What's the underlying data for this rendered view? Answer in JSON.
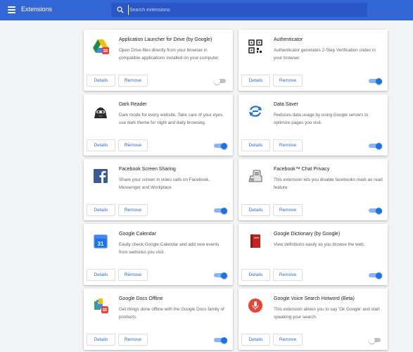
{
  "header": {
    "title": "Extensions",
    "search_placeholder": "Search extensions"
  },
  "extensions": [
    {
      "name": "Application Launcher for Drive (by Google)",
      "description": "Open Drive files directly from your browser in compatible applications installed on your computer.",
      "icon": "google-drive-icon",
      "enabled": false
    },
    {
      "name": "Authenticator",
      "description": "Authenticator generates 2-Step Verification codes in your browser.",
      "icon": "qr-code-icon",
      "enabled": true
    },
    {
      "name": "Dark Reader",
      "description": "Dark mode for every website. Take care of your eyes, use dark theme for night and daily browsing.",
      "icon": "dark-reader-icon",
      "enabled": true
    },
    {
      "name": "Data Saver",
      "description": "Reduces data usage by using Google servers to optimize pages you visit.",
      "icon": "data-saver-icon",
      "enabled": true
    },
    {
      "name": "Facebook Screen Sharing",
      "description": "Share your screen in video calls on Facebook, Messenger and Workplace",
      "icon": "facebook-icon",
      "enabled": true
    },
    {
      "name": "Facebook™ Chat Privacy",
      "description": "This extension lets you disable facebooks mark as read feature",
      "icon": "chat-privacy-icon",
      "enabled": true
    },
    {
      "name": "Google Calendar",
      "description": "Easily check Google Calendar and add new events from websites you visit.",
      "icon": "google-calendar-icon",
      "enabled": true
    },
    {
      "name": "Google Dictionary (by Google)",
      "description": "View definitions easily as you browse the web.",
      "icon": "dictionary-book-icon",
      "enabled": true
    },
    {
      "name": "Google Docs Offline",
      "description": "Get things done offline with the Google Docs family of products.",
      "icon": "google-docs-icon",
      "enabled": true
    },
    {
      "name": "Google Voice Search Hotword (Beta)",
      "description": "This extension allows you to say 'Ok Google' and start speaking your search.",
      "icon": "microphone-icon",
      "enabled": false
    }
  ],
  "labels": {
    "details": "Details",
    "remove": "Remove"
  },
  "colors": {
    "accent": "#3367d6",
    "toggle_on": "#1a73e8"
  }
}
